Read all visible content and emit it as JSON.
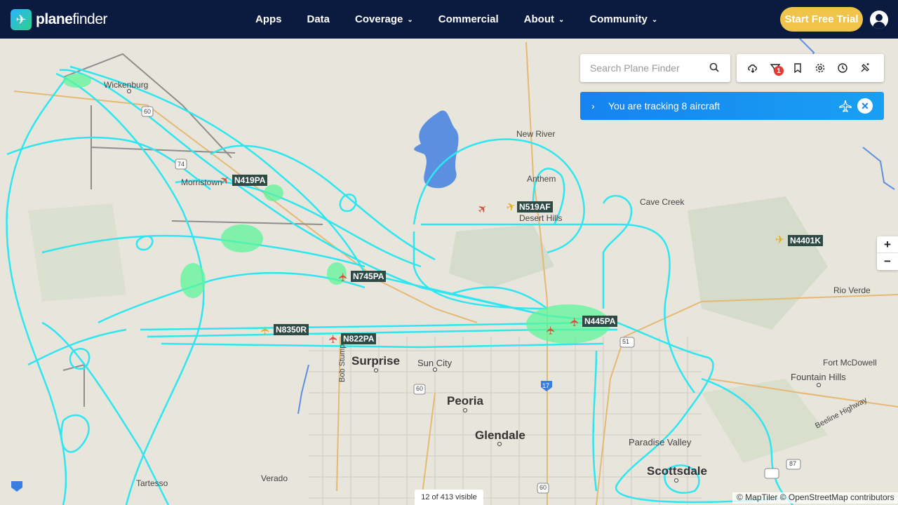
{
  "brand": {
    "name_bold": "plane",
    "name_light": "finder"
  },
  "nav": {
    "items": [
      {
        "label": "Apps",
        "dropdown": false
      },
      {
        "label": "Data",
        "dropdown": false
      },
      {
        "label": "Coverage",
        "dropdown": true
      },
      {
        "label": "Commercial",
        "dropdown": false
      },
      {
        "label": "About",
        "dropdown": true
      },
      {
        "label": "Community",
        "dropdown": true
      }
    ],
    "cta_label": "Start Free Trial"
  },
  "search": {
    "placeholder": "Search Plane Finder"
  },
  "toolbar": {
    "icons": [
      "weather-icon",
      "filter-icon",
      "bookmark-icon",
      "settings-icon",
      "history-icon",
      "playback-icon"
    ],
    "filter_badge": "1"
  },
  "tracking": {
    "text": "You are tracking 8 aircraft"
  },
  "zoom": {
    "in": "+",
    "out": "−"
  },
  "places": {
    "wickenburg": "Wickenburg",
    "morristown": "Morristown",
    "new_river": "New River",
    "anthem": "Anthem",
    "cave_creek": "Cave Creek",
    "desert_hills": "Desert Hills",
    "rio_verde": "Rio Verde",
    "fort_mcdowell": "Fort McDowell",
    "fountain_hills": "Fountain Hills",
    "surprise": "Surprise",
    "sun_city": "Sun City",
    "peoria": "Peoria",
    "glendale": "Glendale",
    "paradise_valley": "Paradise Valley",
    "scottsdale": "Scottsdale",
    "verado": "Verado",
    "tartesso": "Tartesso",
    "beeline_highway": "Beeline Highway",
    "bob_stump": "Bob Stump",
    "hwy_60_a": "60",
    "hwy_60_b": "60",
    "hwy_60_c": "60",
    "hwy_51": "51",
    "hwy_17": "17",
    "hwy_87": "87",
    "hwy_74": "74"
  },
  "aircraft": [
    {
      "callsign": "N419PA",
      "color": "#d84a3a"
    },
    {
      "callsign": "N519AF",
      "color": "#e0b020"
    },
    {
      "callsign": "N4401K",
      "color": "#e0b020"
    },
    {
      "callsign": "N745PA",
      "color": "#d84a3a"
    },
    {
      "callsign": "N445PA",
      "color": "#d84a3a"
    },
    {
      "callsign": "N8350R",
      "color": "#e0b020"
    },
    {
      "callsign": "N822PA",
      "color": "#d84a3a"
    }
  ],
  "footer": {
    "visible_count": "12 of 413 visible",
    "attribution": "© MapTiler © OpenStreetMap contributors"
  },
  "colors": {
    "nav_bg": "#0b1b3f",
    "cta": "#f0c44a",
    "track": "#2ee6f0",
    "track_dense": "#5ef59a",
    "tracking_bar": "#1583f0",
    "water": "#5b8fe0"
  }
}
